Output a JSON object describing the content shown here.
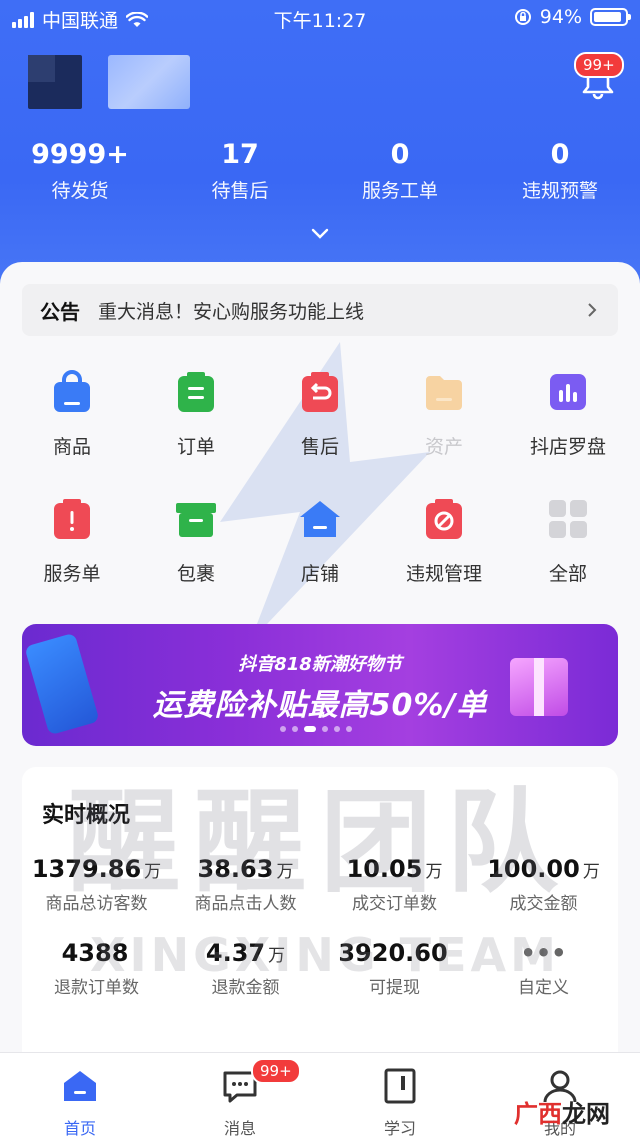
{
  "status_bar": {
    "carrier": "中国联通",
    "time": "下午11:27",
    "battery": "94%"
  },
  "header": {
    "bell_badge": "99+",
    "stats": [
      {
        "value": "9999+",
        "label": "待发货"
      },
      {
        "value": "17",
        "label": "待售后"
      },
      {
        "value": "0",
        "label": "服务工单"
      },
      {
        "value": "0",
        "label": "违规预警"
      }
    ]
  },
  "notice": {
    "tag": "公告",
    "message": "重大消息！安心购服务功能上线"
  },
  "grid": [
    {
      "label": "商品",
      "icon": "bag-icon",
      "color": "#3a7bf6"
    },
    {
      "label": "订单",
      "icon": "clipboard-icon",
      "color": "#2fb34a"
    },
    {
      "label": "售后",
      "icon": "return-icon",
      "color": "#ef4a55"
    },
    {
      "label": "资产",
      "icon": "folder-icon",
      "color": "#f5c98a"
    },
    {
      "label": "抖店罗盘",
      "icon": "chart-icon",
      "color": "#7b5cf2"
    },
    {
      "label": "服务单",
      "icon": "alert-icon",
      "color": "#ef4a55"
    },
    {
      "label": "包裹",
      "icon": "box-icon",
      "color": "#2fb34a"
    },
    {
      "label": "店铺",
      "icon": "house-icon",
      "color": "#3a7bf6"
    },
    {
      "label": "违规管理",
      "icon": "forbidden-icon",
      "color": "#ef4a55"
    },
    {
      "label": "全部",
      "icon": "grid-icon",
      "color": "#d4d4d8"
    }
  ],
  "banner": {
    "subtitle": "抖音818新潮好物节",
    "title": "运费险补贴最高50%/单"
  },
  "overview": {
    "title": "实时概况",
    "rows": [
      [
        {
          "value": "1379.86",
          "unit": "万",
          "label": "商品总访客数"
        },
        {
          "value": "38.63",
          "unit": "万",
          "label": "商品点击人数"
        },
        {
          "value": "10.05",
          "unit": "万",
          "label": "成交订单数"
        },
        {
          "value": "100.00",
          "unit": "万",
          "label": "成交金额"
        }
      ],
      [
        {
          "value": "4388",
          "unit": "",
          "label": "退款订单数"
        },
        {
          "value": "4.37",
          "unit": "万",
          "label": "退款金额"
        },
        {
          "value": "3920.60",
          "unit": "",
          "label": "可提现"
        },
        {
          "value": "•••",
          "unit": "",
          "label": "自定义"
        }
      ]
    ]
  },
  "watermark": {
    "text": "醒醒团队",
    "sub": "XINGXING TEAM"
  },
  "tabbar": [
    {
      "label": "首页",
      "active": true
    },
    {
      "label": "消息",
      "badge": "99+"
    },
    {
      "label": "学习"
    },
    {
      "label": "我的"
    }
  ],
  "site_mark": {
    "a": "广西",
    "b": "龙网"
  },
  "accent": "#3a68f4"
}
